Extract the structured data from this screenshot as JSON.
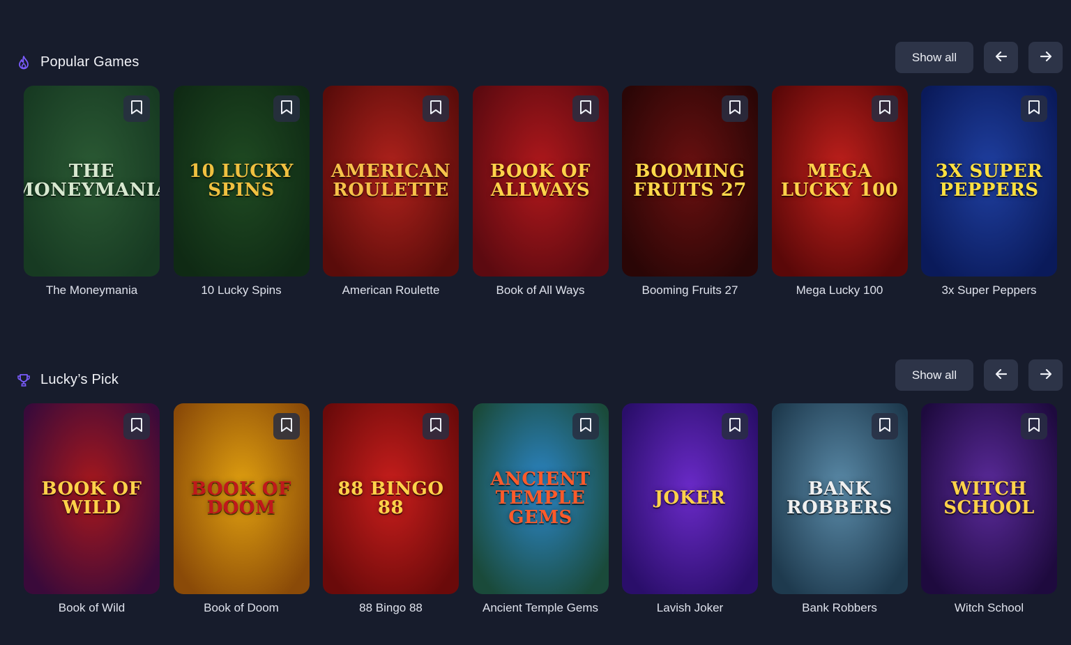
{
  "sections": [
    {
      "title": "Popular Games",
      "icon": "flame-icon",
      "show_all": "Show all",
      "games": [
        {
          "name": "The Moneymania",
          "art": "THE MONEYMANIA",
          "bg": "#2b5a34",
          "bg2": "#173a22",
          "fg": "#d8e8d0"
        },
        {
          "name": "10 Lucky Spins",
          "art": "10 LUCKY SPINS",
          "bg": "#1f4a22",
          "bg2": "#0f2a14",
          "fg": "#f0c040"
        },
        {
          "name": "American Roulette",
          "art": "AMERICAN ROULETTE",
          "bg": "#b0221c",
          "bg2": "#5a0c0a",
          "fg": "#f6c24a"
        },
        {
          "name": "Book of All Ways",
          "art": "BOOK of ALLWAYS",
          "bg": "#b0181c",
          "bg2": "#5c0a10",
          "fg": "#ffd24a"
        },
        {
          "name": "Booming Fruits 27",
          "art": "BOOMING FRUITS 27",
          "bg": "#6a1010",
          "bg2": "#2a0606",
          "fg": "#ffd84a"
        },
        {
          "name": "Mega Lucky 100",
          "art": "Mega Lucky 100",
          "bg": "#c0201c",
          "bg2": "#5a0808",
          "fg": "#ffd24a"
        },
        {
          "name": "3x Super Peppers",
          "art": "3x SUPER PEPPERS",
          "bg": "#1f3fa0",
          "bg2": "#0a1a5a",
          "fg": "#ffe040"
        }
      ]
    },
    {
      "title": "Lucky’s Pick",
      "icon": "trophy-icon",
      "show_all": "Show all",
      "games": [
        {
          "name": "Book of Wild",
          "art": "BOOK OF WILD",
          "bg": "#a8181c",
          "bg2": "#3a0a3a",
          "fg": "#ffd24a"
        },
        {
          "name": "Book of Doom",
          "art": "BOOK of DOOM",
          "bg": "#e0a010",
          "bg2": "#8a4a08",
          "fg": "#c0181c"
        },
        {
          "name": "88 Bingo 88",
          "art": "88 BINGO 88",
          "bg": "#c81e1c",
          "bg2": "#6a0a0a",
          "fg": "#ffd24a"
        },
        {
          "name": "Ancient Temple Gems",
          "art": "ANCIENT TEMPLE GEMS",
          "bg": "#2c86c8",
          "bg2": "#1a4a3a",
          "fg": "#ff5a2a"
        },
        {
          "name": "Lavish Joker",
          "art": "JOKER",
          "bg": "#6a2ac8",
          "bg2": "#2a0e6a",
          "fg": "#ffd24a"
        },
        {
          "name": "Bank Robbers",
          "art": "BANK ROBBERS",
          "bg": "#5a8aa8",
          "bg2": "#1e3a4e",
          "fg": "#f0f0f0"
        },
        {
          "name": "Witch School",
          "art": "WITCH SCHOOL",
          "bg": "#5a2a9a",
          "bg2": "#1e0a3e",
          "fg": "#ffd24a"
        }
      ]
    }
  ]
}
